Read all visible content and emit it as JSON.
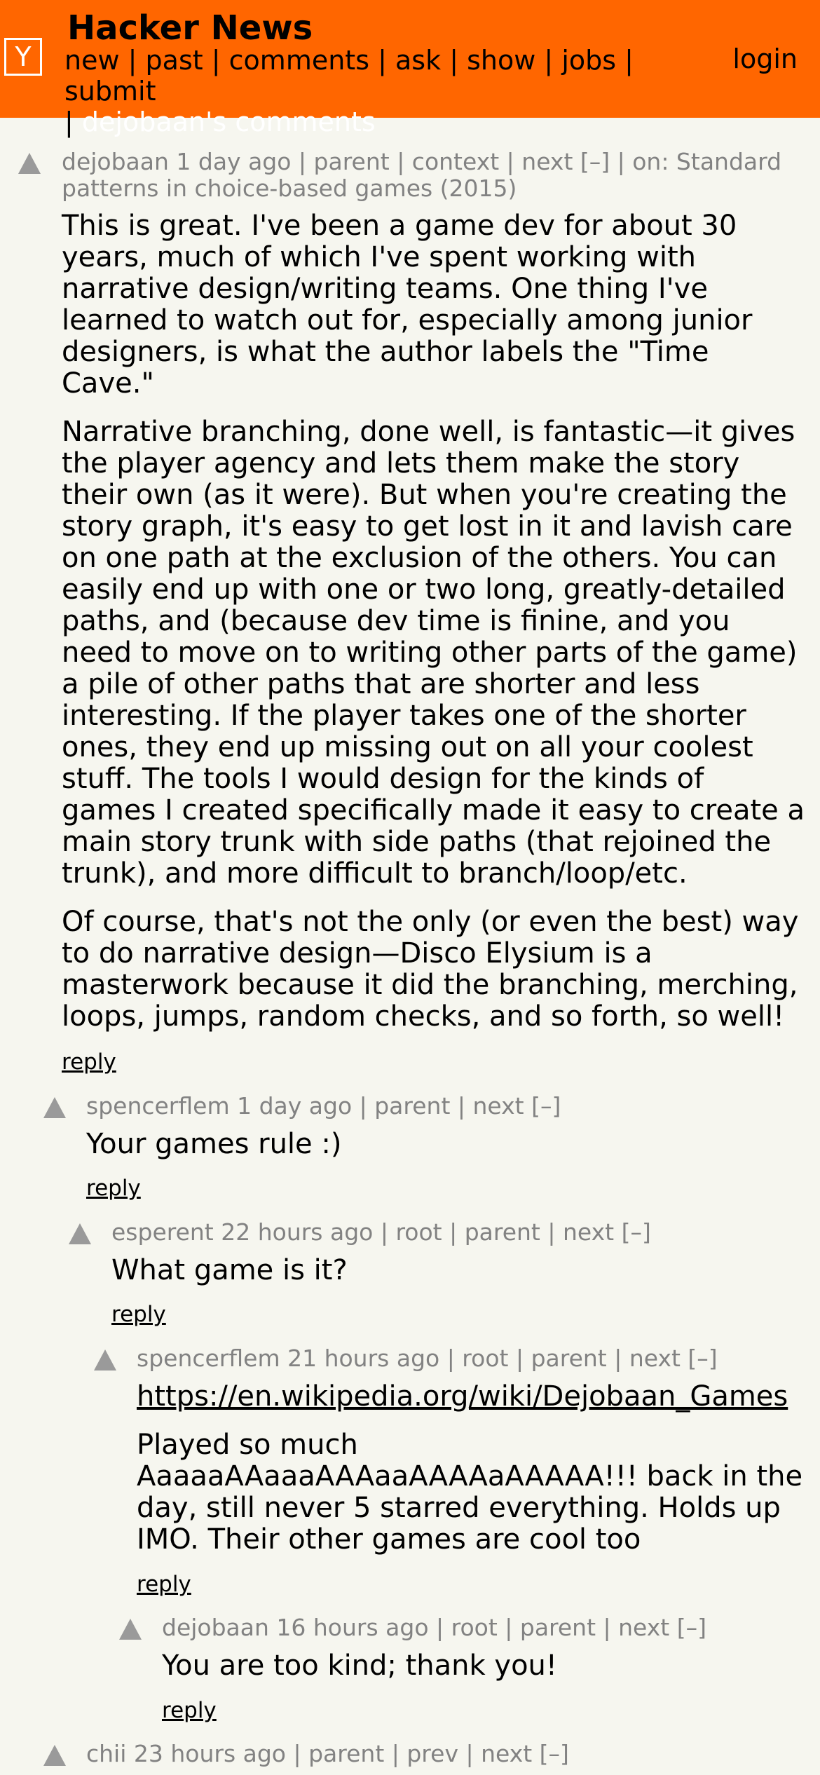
{
  "header": {
    "logo": "Y",
    "title": "Hacker News",
    "nav": [
      "new",
      "past",
      "comments",
      "ask",
      "show",
      "jobs",
      "submit"
    ],
    "active_label": "dejobaan's comments",
    "login": "login"
  },
  "comments": [
    {
      "meta": "dejobaan 1 day ago | parent | context | next [–] | on: Standard patterns in choice-based games (2015)",
      "paragraphs": [
        "This is great. I've been a game dev for about 30 years, much of which I've spent working with narrative design/writing teams. One thing I've learned to watch out for, especially among junior designers, is what the author labels the \"Time Cave.\"",
        "Narrative branching, done well, is fantastic—it gives the player agency and lets them make the story their own (as it were). But when you're creating the story graph, it's easy to get lost in it and lavish care on one path at the exclusion of the others. You can easily end up with one or two long, greatly-detailed paths, and (because dev time is finine, and you need to move on to writing other parts of the game) a pile of other paths that are shorter and less interesting. If the player takes one of the shorter ones, they end up missing out on all your coolest stuff. The tools I would design for the kinds of games I created specifically made it easy to create a main story trunk with side paths (that rejoined the trunk), and more difficult to branch/loop/etc.",
        "Of course, that's not the only (or even the best) way to do narrative design—Disco Elysium is a masterwork because it did the branching, merching, loops, jumps, random checks, and so forth, so well!"
      ],
      "reply": "reply"
    },
    {
      "meta": "spencerflem 1 day ago | parent | next [–]",
      "paragraphs": [
        "Your games rule :)"
      ],
      "reply": "reply"
    },
    {
      "meta": "esperent 22 hours ago | root | parent | next [–]",
      "paragraphs": [
        "What game is it?"
      ],
      "reply": "reply"
    },
    {
      "meta": "spencerflem 21 hours ago | root | parent | next [–]",
      "link": "https://en.wikipedia.org/wiki/Dejobaan_Games",
      "paragraphs": [
        "Played so much AaaaaAAaaaAAAaaAAAAaAAAAA!!! back in the day, still never 5 starred everything. Holds up IMO. Their other games are cool too"
      ],
      "reply": "reply"
    },
    {
      "meta": "dejobaan 16 hours ago | root | parent | next [–]",
      "paragraphs": [
        "You are too kind; thank you!"
      ],
      "reply": "reply"
    },
    {
      "meta": "chii 23 hours ago | parent | prev | next [–]"
    }
  ]
}
